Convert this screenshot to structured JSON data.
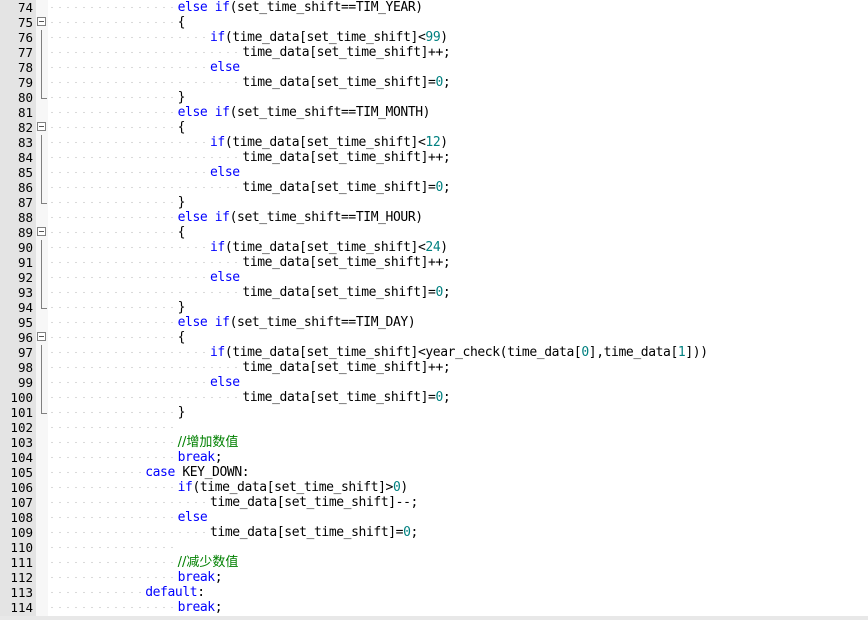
{
  "editor": {
    "lines": [
      {
        "num": "74",
        "indent": 4,
        "tokens": [
          {
            "t": "kw",
            "v": "else "
          },
          {
            "t": "kw",
            "v": "if"
          },
          {
            "t": "",
            "v": "(set_time_shift==TIM_YEAR)"
          }
        ]
      },
      {
        "num": "75",
        "indent": 4,
        "fold": "open",
        "tokens": [
          {
            "t": "",
            "v": "{"
          }
        ]
      },
      {
        "num": "76",
        "indent": 5,
        "tokens": [
          {
            "t": "kw",
            "v": "if"
          },
          {
            "t": "",
            "v": "(time_data[set_time_shift]<"
          },
          {
            "t": "num",
            "v": "99"
          },
          {
            "t": "",
            "v": ")"
          }
        ]
      },
      {
        "num": "77",
        "indent": 6,
        "tokens": [
          {
            "t": "",
            "v": "time_data[set_time_shift]++;"
          }
        ]
      },
      {
        "num": "78",
        "indent": 5,
        "tokens": [
          {
            "t": "kw",
            "v": "else"
          }
        ]
      },
      {
        "num": "79",
        "indent": 6,
        "tokens": [
          {
            "t": "",
            "v": "time_data[set_time_shift]="
          },
          {
            "t": "num",
            "v": "0"
          },
          {
            "t": "",
            "v": ";"
          }
        ]
      },
      {
        "num": "80",
        "indent": 4,
        "fold": "end",
        "tokens": [
          {
            "t": "",
            "v": "}"
          }
        ]
      },
      {
        "num": "81",
        "indent": 4,
        "tokens": [
          {
            "t": "kw",
            "v": "else "
          },
          {
            "t": "kw",
            "v": "if"
          },
          {
            "t": "",
            "v": "(set_time_shift==TIM_MONTH)"
          }
        ]
      },
      {
        "num": "82",
        "indent": 4,
        "fold": "open",
        "tokens": [
          {
            "t": "",
            "v": "{"
          }
        ]
      },
      {
        "num": "83",
        "indent": 5,
        "tokens": [
          {
            "t": "kw",
            "v": "if"
          },
          {
            "t": "",
            "v": "(time_data[set_time_shift]<"
          },
          {
            "t": "num",
            "v": "12"
          },
          {
            "t": "",
            "v": ")"
          }
        ]
      },
      {
        "num": "84",
        "indent": 6,
        "tokens": [
          {
            "t": "",
            "v": "time_data[set_time_shift]++;"
          }
        ]
      },
      {
        "num": "85",
        "indent": 5,
        "tokens": [
          {
            "t": "kw",
            "v": "else"
          }
        ]
      },
      {
        "num": "86",
        "indent": 6,
        "tokens": [
          {
            "t": "",
            "v": "time_data[set_time_shift]="
          },
          {
            "t": "num",
            "v": "0"
          },
          {
            "t": "",
            "v": ";"
          }
        ]
      },
      {
        "num": "87",
        "indent": 4,
        "fold": "end",
        "tokens": [
          {
            "t": "",
            "v": "}"
          }
        ]
      },
      {
        "num": "88",
        "indent": 4,
        "tokens": [
          {
            "t": "kw",
            "v": "else "
          },
          {
            "t": "kw",
            "v": "if"
          },
          {
            "t": "",
            "v": "(set_time_shift==TIM_HOUR)"
          }
        ]
      },
      {
        "num": "89",
        "indent": 4,
        "fold": "open",
        "tokens": [
          {
            "t": "",
            "v": "{"
          }
        ]
      },
      {
        "num": "90",
        "indent": 5,
        "tokens": [
          {
            "t": "kw",
            "v": "if"
          },
          {
            "t": "",
            "v": "(time_data[set_time_shift]<"
          },
          {
            "t": "num",
            "v": "24"
          },
          {
            "t": "",
            "v": ")"
          }
        ]
      },
      {
        "num": "91",
        "indent": 6,
        "tokens": [
          {
            "t": "",
            "v": "time_data[set_time_shift]++;"
          }
        ]
      },
      {
        "num": "92",
        "indent": 5,
        "tokens": [
          {
            "t": "kw",
            "v": "else"
          }
        ]
      },
      {
        "num": "93",
        "indent": 6,
        "tokens": [
          {
            "t": "",
            "v": "time_data[set_time_shift]="
          },
          {
            "t": "num",
            "v": "0"
          },
          {
            "t": "",
            "v": ";"
          }
        ]
      },
      {
        "num": "94",
        "indent": 4,
        "fold": "end",
        "tokens": [
          {
            "t": "",
            "v": "}"
          }
        ]
      },
      {
        "num": "95",
        "indent": 4,
        "tokens": [
          {
            "t": "kw",
            "v": "else "
          },
          {
            "t": "kw",
            "v": "if"
          },
          {
            "t": "",
            "v": "(set_time_shift==TIM_DAY)"
          }
        ]
      },
      {
        "num": "96",
        "indent": 4,
        "fold": "open",
        "tokens": [
          {
            "t": "",
            "v": "{"
          }
        ]
      },
      {
        "num": "97",
        "indent": 5,
        "tokens": [
          {
            "t": "kw",
            "v": "if"
          },
          {
            "t": "",
            "v": "(time_data[set_time_shift]<year_check(time_data["
          },
          {
            "t": "num",
            "v": "0"
          },
          {
            "t": "",
            "v": "],time_data["
          },
          {
            "t": "num",
            "v": "1"
          },
          {
            "t": "",
            "v": "]))"
          }
        ]
      },
      {
        "num": "98",
        "indent": 6,
        "tokens": [
          {
            "t": "",
            "v": "time_data[set_time_shift]++;"
          }
        ]
      },
      {
        "num": "99",
        "indent": 5,
        "tokens": [
          {
            "t": "kw",
            "v": "else"
          }
        ]
      },
      {
        "num": "100",
        "indent": 6,
        "tokens": [
          {
            "t": "",
            "v": "time_data[set_time_shift]="
          },
          {
            "t": "num",
            "v": "0"
          },
          {
            "t": "",
            "v": ";"
          }
        ]
      },
      {
        "num": "101",
        "indent": 4,
        "fold": "end",
        "tokens": [
          {
            "t": "",
            "v": "}"
          }
        ]
      },
      {
        "num": "102",
        "indent": 0,
        "tokens": []
      },
      {
        "num": "103",
        "indent": 4,
        "tokens": [
          {
            "t": "cmt",
            "v": "//增加数值"
          }
        ]
      },
      {
        "num": "104",
        "indent": 4,
        "tokens": [
          {
            "t": "kw",
            "v": "break"
          },
          {
            "t": "",
            "v": ";"
          }
        ]
      },
      {
        "num": "105",
        "indent": 3,
        "tokens": [
          {
            "t": "kw",
            "v": "case"
          },
          {
            "t": "",
            "v": " KEY_DOWN:"
          }
        ]
      },
      {
        "num": "106",
        "indent": 4,
        "tokens": [
          {
            "t": "kw",
            "v": "if"
          },
          {
            "t": "",
            "v": "(time_data[set_time_shift]>"
          },
          {
            "t": "num",
            "v": "0"
          },
          {
            "t": "",
            "v": ")"
          }
        ]
      },
      {
        "num": "107",
        "indent": 5,
        "tokens": [
          {
            "t": "",
            "v": "time_data[set_time_shift]--;"
          }
        ]
      },
      {
        "num": "108",
        "indent": 4,
        "tokens": [
          {
            "t": "kw",
            "v": "else"
          }
        ]
      },
      {
        "num": "109",
        "indent": 5,
        "tokens": [
          {
            "t": "",
            "v": "time_data[set_time_shift]="
          },
          {
            "t": "num",
            "v": "0"
          },
          {
            "t": "",
            "v": ";"
          }
        ]
      },
      {
        "num": "110",
        "indent": 0,
        "tokens": []
      },
      {
        "num": "111",
        "indent": 4,
        "tokens": [
          {
            "t": "cmt",
            "v": "//减少数值"
          }
        ]
      },
      {
        "num": "112",
        "indent": 4,
        "tokens": [
          {
            "t": "kw",
            "v": "break"
          },
          {
            "t": "",
            "v": ";"
          }
        ]
      },
      {
        "num": "113",
        "indent": 3,
        "tokens": [
          {
            "t": "kw",
            "v": "default"
          },
          {
            "t": "",
            "v": ":"
          }
        ]
      },
      {
        "num": "114",
        "indent": 4,
        "tokens": [
          {
            "t": "kw",
            "v": "break"
          },
          {
            "t": "",
            "v": ";"
          }
        ]
      }
    ]
  },
  "colors": {
    "keyword": "#0000ff",
    "number": "#008080",
    "comment": "#008000",
    "text": "#000000",
    "gutter": "#e4e4e4"
  }
}
